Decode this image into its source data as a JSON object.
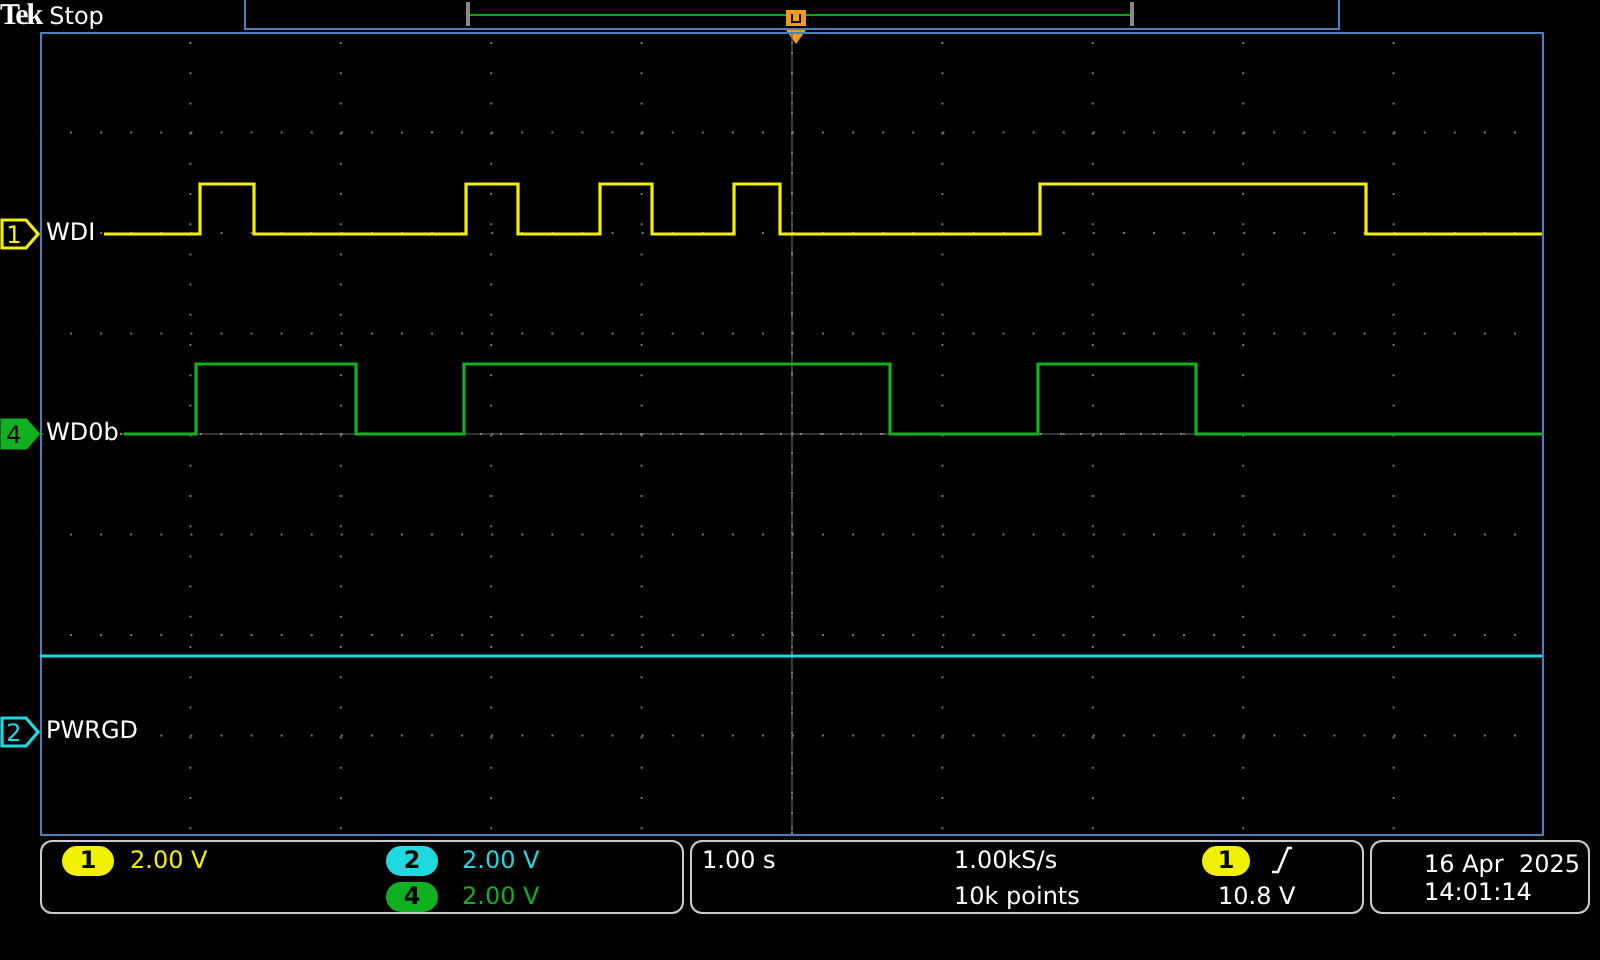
{
  "header": {
    "brand": "Tek",
    "status": "Stop"
  },
  "channels": [
    {
      "number": "1",
      "label": "WDI",
      "color": "#f0f000",
      "selected": false
    },
    {
      "number": "4",
      "label": "WD0b",
      "color": "#10b020",
      "selected": true
    },
    {
      "number": "2",
      "label": "PWRGD",
      "color": "#20d8e0",
      "selected": false
    }
  ],
  "vertical": [
    {
      "number": "1",
      "scale": "2.00 V",
      "color": "#f0f000"
    },
    {
      "number": "2",
      "scale": "2.00 V",
      "color": "#20d8e0"
    },
    {
      "number": "4",
      "scale": "2.00 V",
      "color": "#10b020"
    }
  ],
  "horizontal": {
    "scale": "1.00 s",
    "sample_rate": "1.00kS/s",
    "record_length": "10k points"
  },
  "trigger": {
    "source": "1",
    "color": "#f0f000",
    "level": "10.8 V"
  },
  "clock": {
    "date": "16 Apr  2025",
    "time": "14:01:14"
  }
}
